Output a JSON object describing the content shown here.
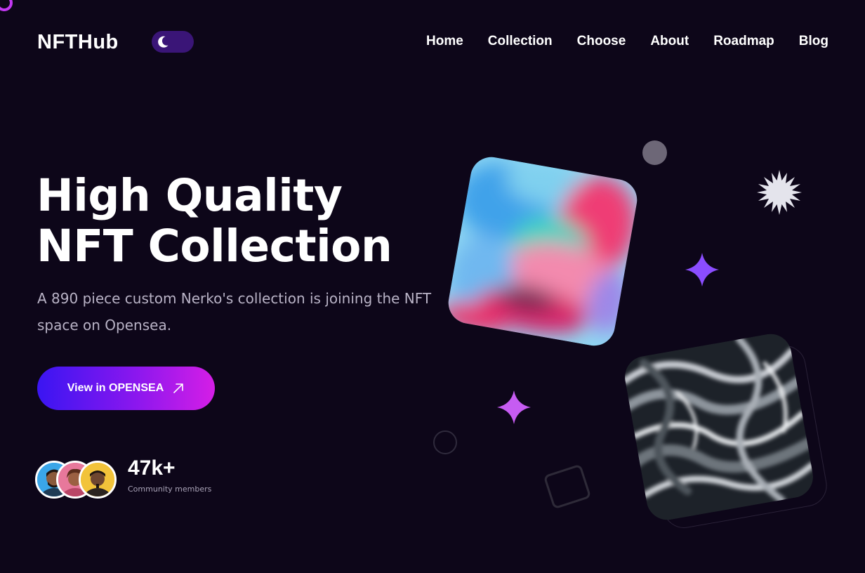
{
  "header": {
    "logo": "NFTHub",
    "theme_toggle_icon": "moon-icon",
    "nav": [
      "Home",
      "Collection",
      "Choose",
      "About",
      "Roadmap",
      "Blog"
    ]
  },
  "hero": {
    "title_line1": "High Quality",
    "title_line2": "NFT Collection",
    "subtitle": "A 890 piece custom Nerko's collection is joining the NFT space on Opensea.",
    "cta_label": "View in OPENSEA",
    "cta_icon": "arrow-up-right-icon"
  },
  "community": {
    "count": "47k+",
    "label": "Community members",
    "avatars": [
      "avatar-blue",
      "avatar-pink",
      "avatar-yellow"
    ]
  },
  "colors": {
    "background": "#0d0619",
    "accent_gradient_start": "#3a15f2",
    "accent_gradient_end": "#d51ee6",
    "star_purple": "#8b4dff",
    "star_pink": "#c65cf2",
    "burst_white": "#e4e4ec"
  },
  "decorations": {
    "artworks": [
      "abstract-paint-artwork",
      "liquid-marble-artwork"
    ],
    "shapes": [
      "sparkle-burst-icon",
      "four-point-star-icon",
      "four-point-star-icon",
      "circle-dot",
      "circle-ring",
      "square-outline"
    ]
  }
}
